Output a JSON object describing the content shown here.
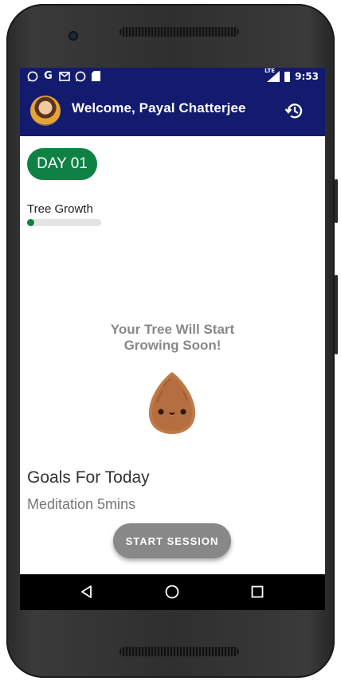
{
  "status_bar": {
    "left_icons": [
      "whatsapp-icon",
      "google-icon",
      "gmail-icon",
      "whatsapp-icon",
      "sd-card-icon"
    ],
    "google_glyph": "G",
    "network_label": "LTE",
    "time": "9:53"
  },
  "app_bar": {
    "title": "Welcome, Payal Chatterjee",
    "action_icon": "history-icon"
  },
  "day_badge": "DAY 01",
  "tree_growth": {
    "label": "Tree Growth",
    "progress": 0.1,
    "color": "#0f8145"
  },
  "tree_message": [
    "Your Tree Will Start",
    "Growing Soon!"
  ],
  "seed_icon": "seed-character-icon",
  "goals": {
    "title": "Goals For Today",
    "items": [
      "Meditation 5mins"
    ]
  },
  "start_button": "START SESSION",
  "nav_bar": {
    "icons": [
      "back-icon",
      "home-icon",
      "recents-icon"
    ]
  },
  "colors": {
    "app_bar": "#131b6f",
    "accent_green": "#0f8145",
    "button_grey": "#888888"
  }
}
